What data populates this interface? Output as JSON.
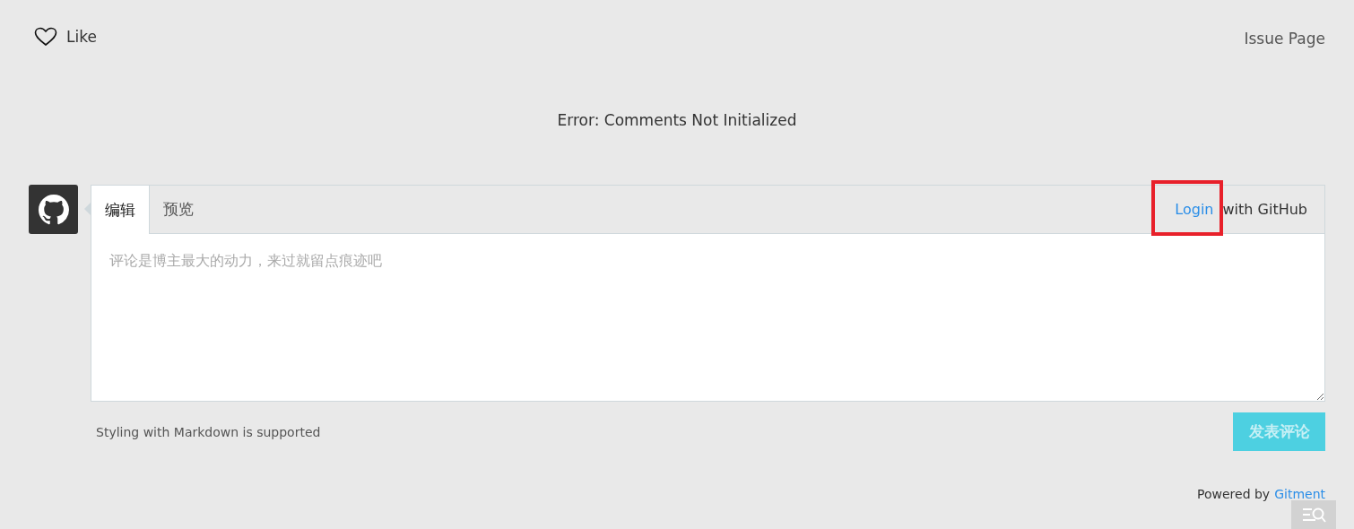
{
  "header": {
    "like": {
      "label": "Like",
      "liked": false
    },
    "issue_link": "Issue Page"
  },
  "error_message": "Error: Comments Not Initialized",
  "editor": {
    "tabs": [
      {
        "label": "编辑",
        "selected": true
      },
      {
        "label": "预览",
        "selected": false
      }
    ],
    "login": {
      "link": "Login",
      "rest": "with GitHub",
      "highlighted": true
    },
    "placeholder": "评论是博主最大的动力，来过就留点痕迹吧"
  },
  "markdown_note": "Styling with Markdown is supported",
  "submit": {
    "label": "发表评论",
    "disabled": true
  },
  "footer": {
    "prefix": "Powered by",
    "link": "Gitment"
  }
}
